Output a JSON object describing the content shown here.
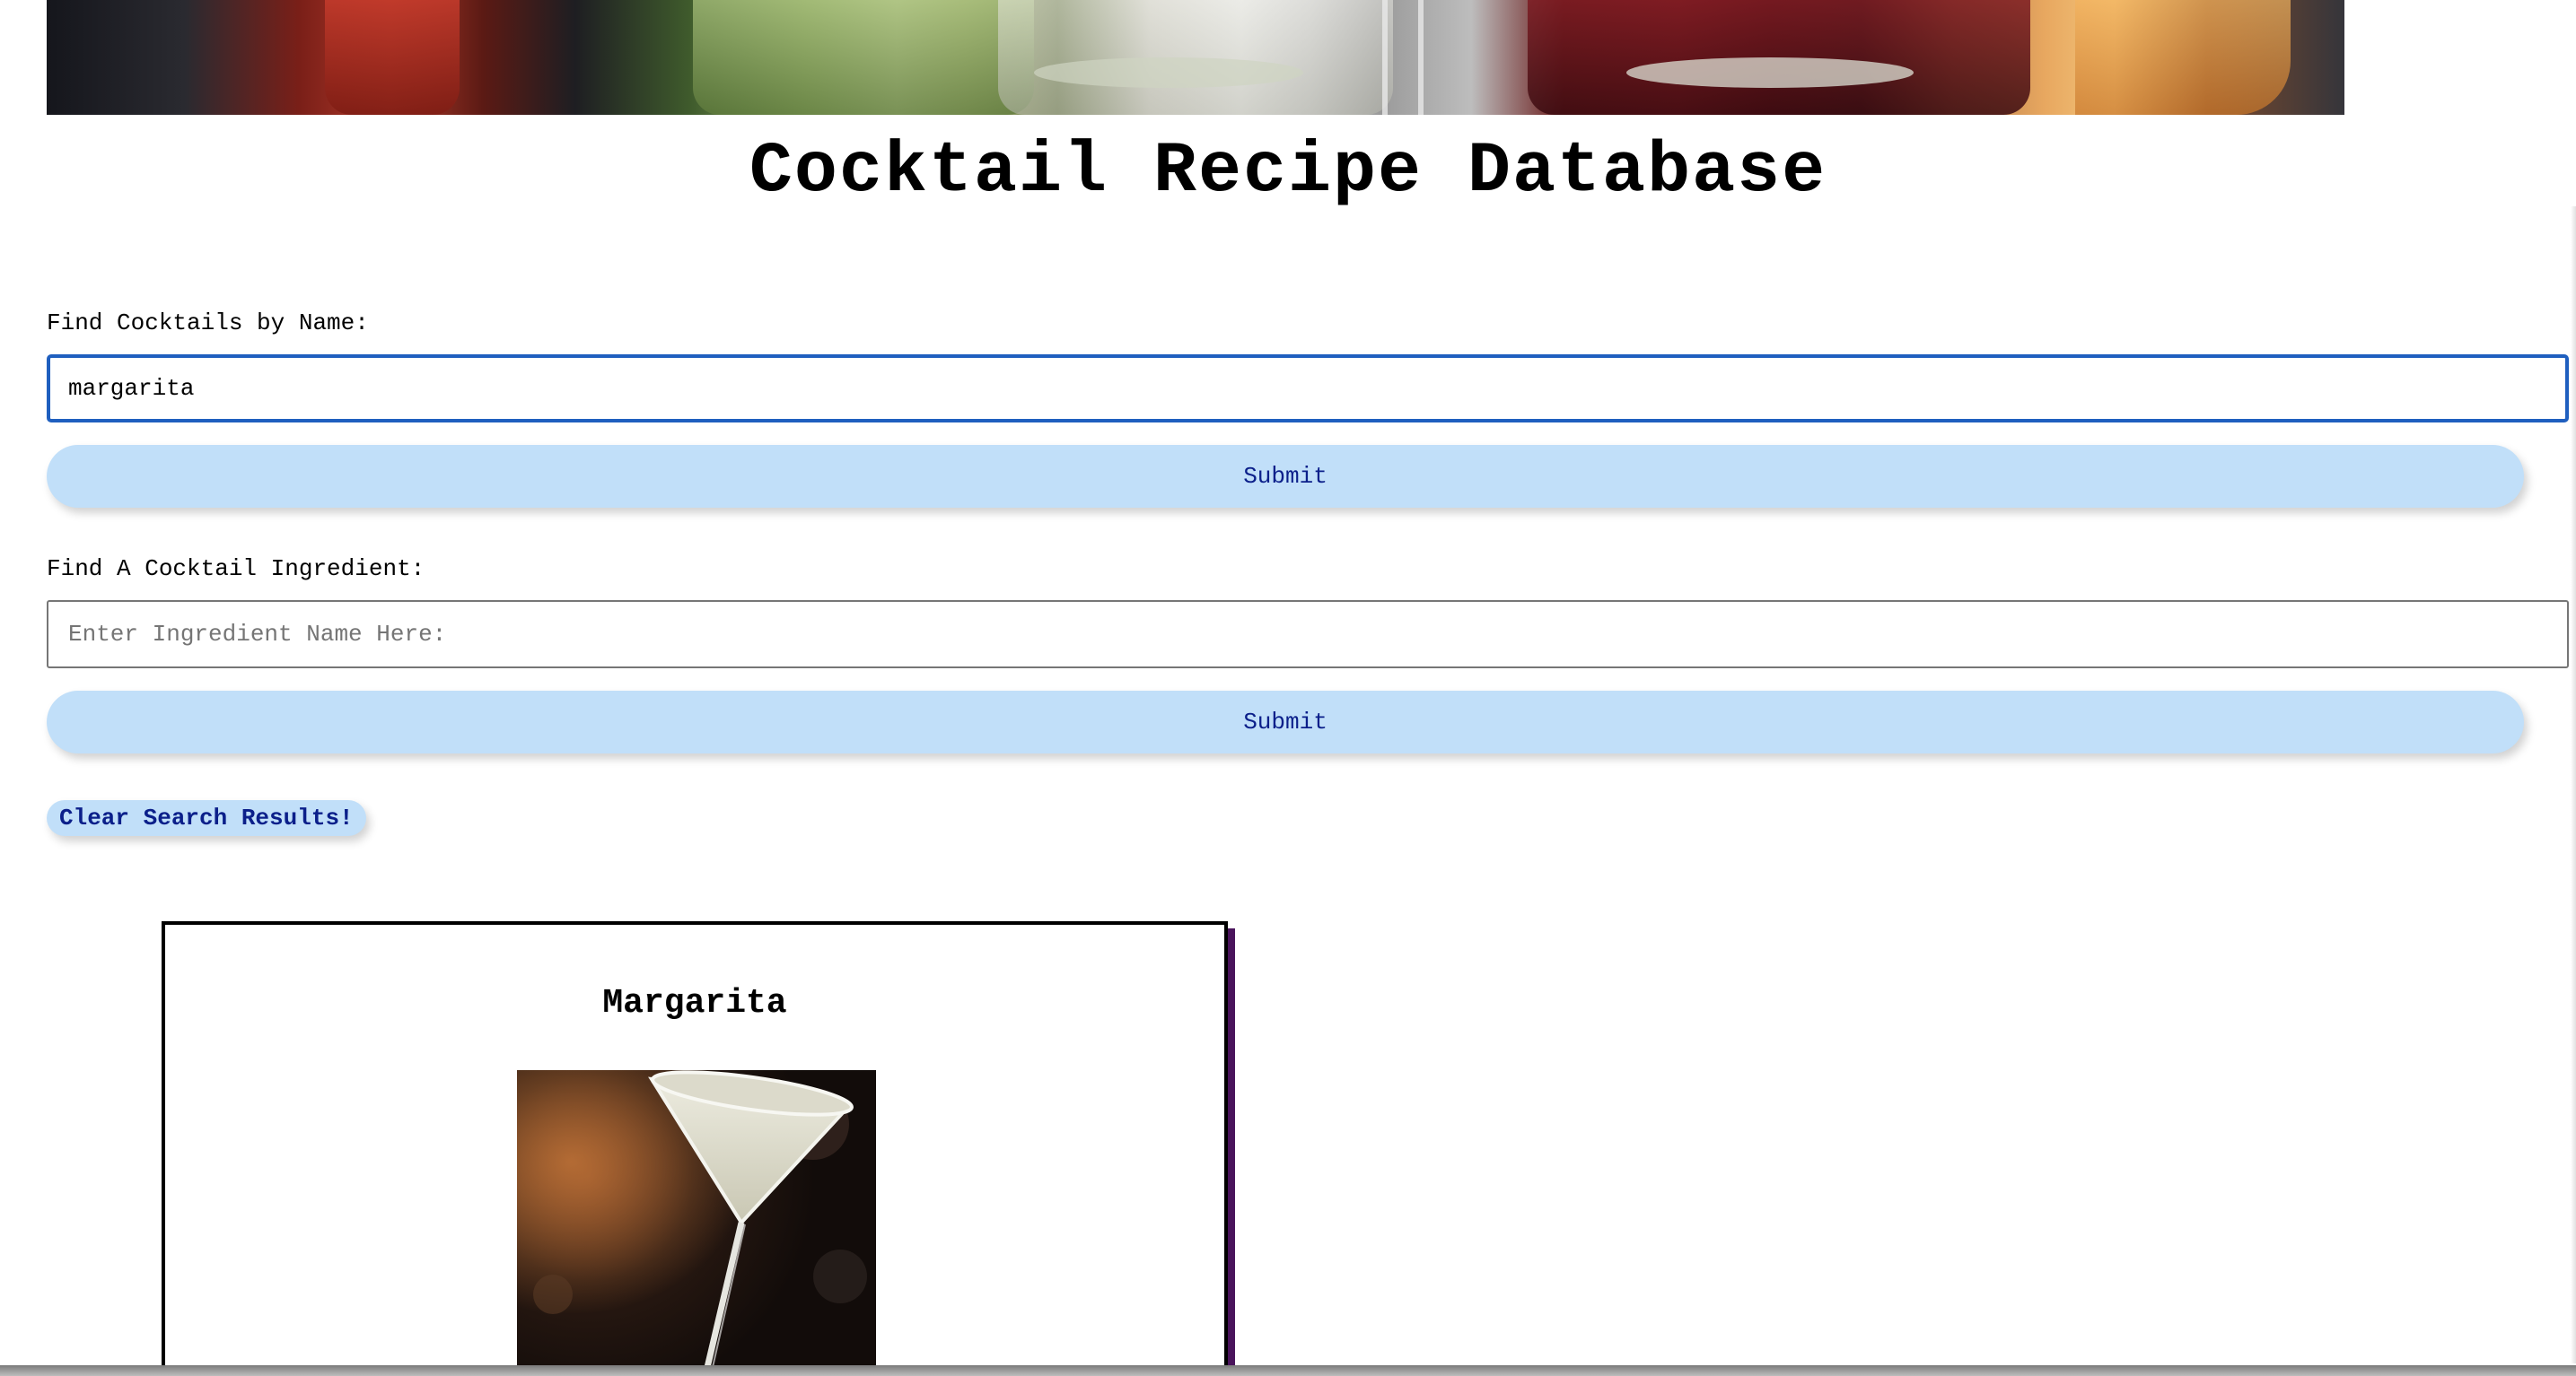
{
  "page": {
    "title": "Cocktail Recipe Database"
  },
  "name_search": {
    "label": "Find Cocktails by Name:",
    "value": "margarita",
    "placeholder": "",
    "submit_label": "Submit"
  },
  "ingredient_search": {
    "label": "Find A Cocktail Ingredient:",
    "value": "",
    "placeholder": "Enter Ingredient Name Here:",
    "submit_label": "Submit"
  },
  "clear_button_label": "Clear Search Results!",
  "results": [
    {
      "name": "Margarita",
      "image": "margarita-photo"
    }
  ],
  "colors": {
    "button_bg": "#c1dff9",
    "button_text": "#0b1f8a",
    "focus_border": "#1f5fbf",
    "card_shadow": "#4a145c"
  }
}
